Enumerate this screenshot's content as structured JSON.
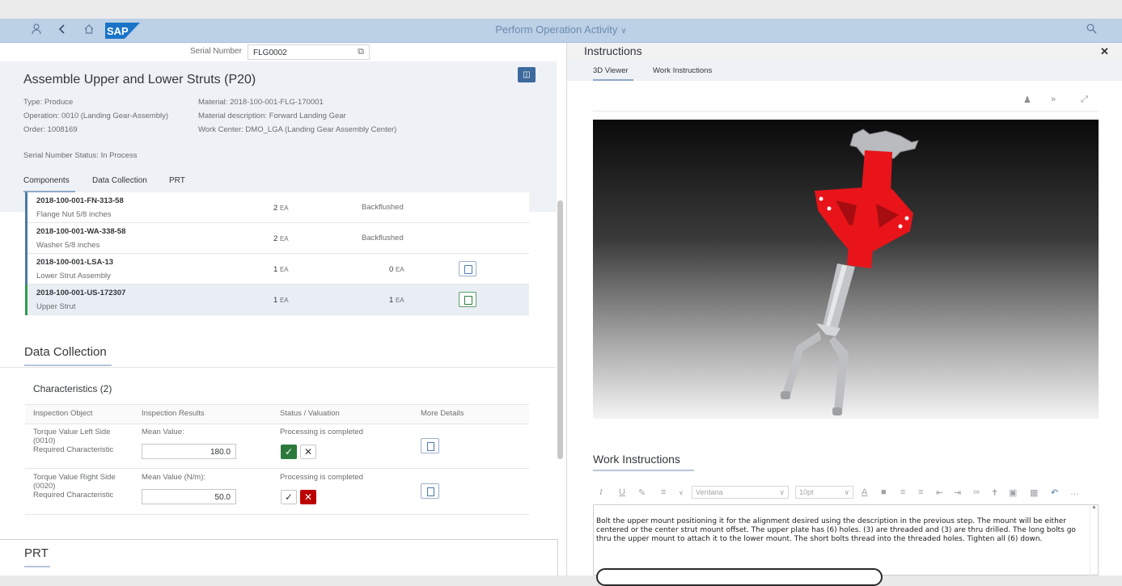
{
  "shell": {
    "title": "Perform Operation Activity",
    "logo_text": "SAP",
    "icons": [
      "person-icon",
      "back-icon",
      "home-icon",
      "search-icon"
    ]
  },
  "serial": {
    "label": "Serial Number",
    "value": "FLG0002"
  },
  "operation": {
    "title": "Assemble Upper and Lower Struts (P20)",
    "type": "Type: Produce",
    "operation": "Operation: 0010 (Landing Gear-Assembly)",
    "order": "Order: 1008169",
    "material": "Material: 2018-100-001-FLG-170001",
    "material_description": "Material description: Forward Landing Gear",
    "work_center": "Work Center: DMO_LGA (Landing Gear Assembly Center)",
    "serial_status": "Serial Number Status: In Process",
    "tabs": [
      "Components",
      "Data Collection",
      "PRT"
    ]
  },
  "components": [
    {
      "id": "2018-100-001-FN-313-58",
      "desc": "Flange Nut 5/8 inches",
      "qty": "2",
      "uom": "EA",
      "status": "Backflushed",
      "assembled": "",
      "assembled_uom": ""
    },
    {
      "id": "2018-100-001-WA-338-58",
      "desc": "Washer 5/8 inches",
      "qty": "2",
      "uom": "EA",
      "status": "Backflushed",
      "assembled": "",
      "assembled_uom": ""
    },
    {
      "id": "2018-100-001-LSA-13",
      "desc": "Lower Strut Assembly",
      "qty": "1",
      "uom": "EA",
      "status": "",
      "assembled": "0",
      "assembled_uom": "EA"
    },
    {
      "id": "2018-100-001-US-172307",
      "desc": "Upper Strut",
      "qty": "1",
      "uom": "EA",
      "status": "",
      "assembled": "1",
      "assembled_uom": "EA"
    }
  ],
  "data_collection": {
    "title": "Data Collection",
    "characteristics_title": "Characteristics (2)",
    "headers": [
      "Inspection Object",
      "Inspection Results",
      "Status / Valuation",
      "More Details"
    ],
    "rows": [
      {
        "object_name": "Torque Value Left Side",
        "object_code": "(0010)",
        "object_type": "Required Characteristic",
        "result_label": "Mean Value:",
        "result_value": "180.0",
        "status": "Processing is completed"
      },
      {
        "object_name": "Torque Value Right Side",
        "object_code": "(0020)",
        "object_type": "Required Characteristic",
        "result_label": "Mean Value (N/m):",
        "result_value": "50.0",
        "status": "Processing is completed"
      }
    ]
  },
  "prt": {
    "title": "PRT"
  },
  "instructions": {
    "title": "Instructions",
    "tabs": [
      "3D Viewer",
      "Work Instructions"
    ],
    "work_instructions_title": "Work Instructions",
    "editor": {
      "font": "Verdana",
      "size": "10pt",
      "text": "Bolt the upper mount positioning it for the alignment desired using the description in the previous step. The mount will be either centered or the center strut mount offset. The upper plate has (6) holes. (3) are threaded and (3) are thru drilled. The long bolts go thru the upper mount to attach it to the lower mount. The short bolts thread into the threaded holes. Tighten all (6) down."
    }
  },
  "colors": {
    "shell": "#bcd0e6",
    "accent": "#3d6a9c",
    "model_red": "#e8141a",
    "accept": "#2b7a3c",
    "reject": "#bb0000"
  }
}
